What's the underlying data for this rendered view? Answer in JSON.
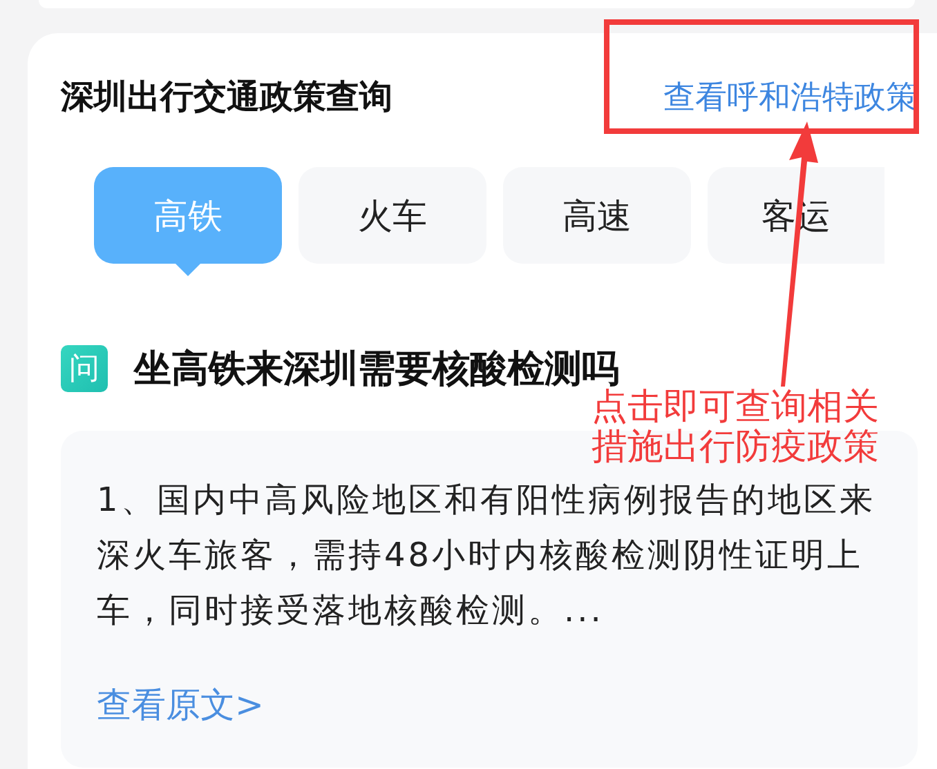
{
  "title": "深圳出行交通政策查询",
  "city_link": "查看呼和浩特政策",
  "tabs": [
    {
      "label": "高铁",
      "selected": true
    },
    {
      "label": "火车",
      "selected": false
    },
    {
      "label": "高速",
      "selected": false
    },
    {
      "label": "客运",
      "selected": false
    }
  ],
  "question": {
    "badge": "问",
    "text": "坐高铁来深圳需要核酸检测吗"
  },
  "answer": {
    "text": "1、国内中高风险地区和有阳性病例报告的地区来深火车旅客，需持48小时内核酸检测阴性证明上车，同时接受落地核酸检测。...",
    "link": "查看原文>"
  },
  "annotation": {
    "text": "点击即可查询相关措施出行防疫政策"
  }
}
